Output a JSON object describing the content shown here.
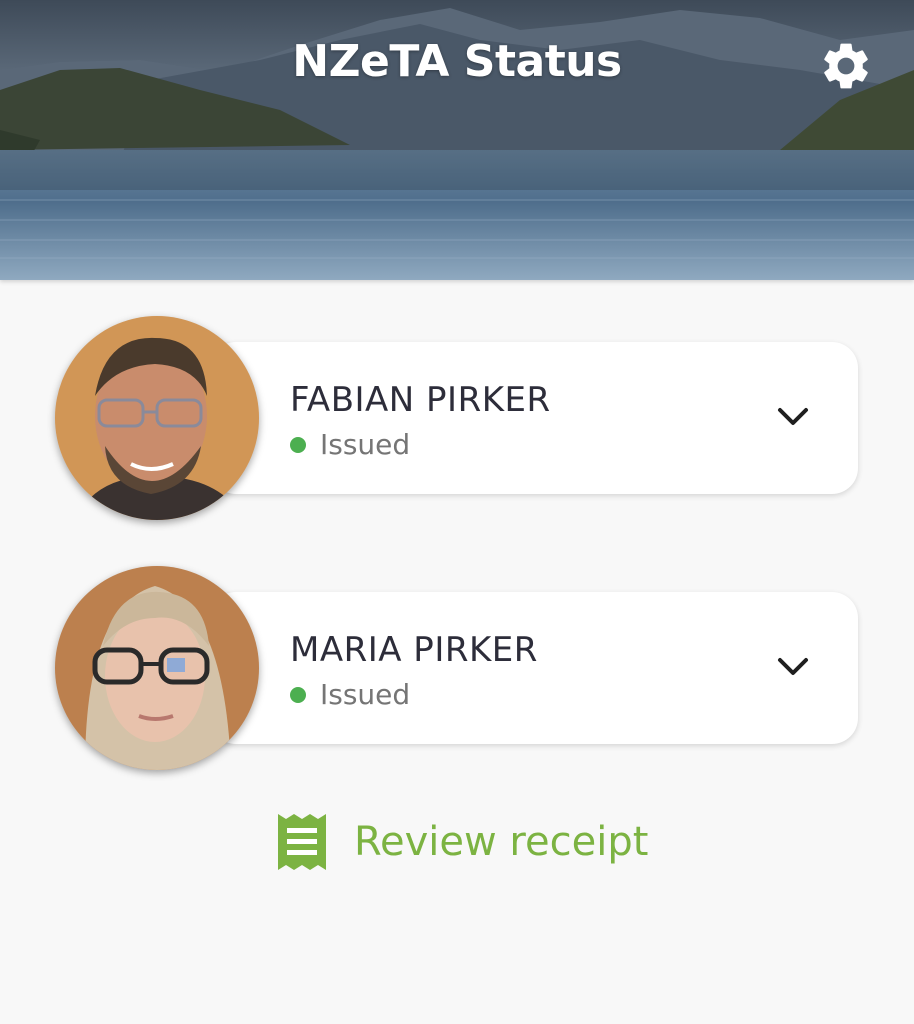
{
  "header": {
    "title": "NZeTA Status",
    "settings_icon": "gear-icon"
  },
  "travellers": [
    {
      "name": "FABIAN PIRKER",
      "status": "Issued",
      "expand_icon": "chevron-down-icon"
    },
    {
      "name": "MARIA PIRKER",
      "status": "Issued",
      "expand_icon": "chevron-down-icon"
    }
  ],
  "receipt": {
    "label": "Review receipt",
    "icon": "receipt-icon"
  },
  "colors": {
    "accent_green": "#7cb342",
    "status_green": "#4caf50",
    "background": "#f8f8f8",
    "card": "#ffffff",
    "name_text": "#2d2d3a",
    "status_text": "#757575"
  }
}
